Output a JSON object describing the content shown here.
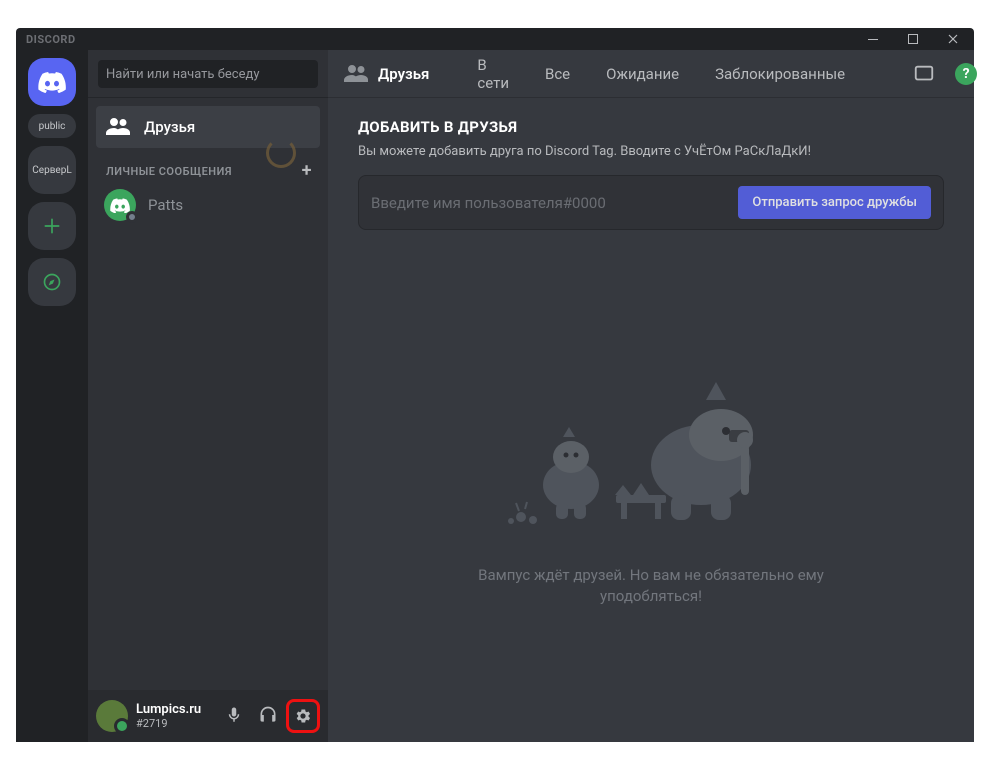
{
  "titlebar": {
    "app_name": "DISCORD"
  },
  "servers": {
    "public_label": "public",
    "server2_label": "СерверL"
  },
  "search": {
    "placeholder": "Найти или начать беседу"
  },
  "channels": {
    "friends_label": "Друзья",
    "dm_header": "ЛИЧНЫЕ СООБЩЕНИЯ",
    "dm_items": [
      {
        "name": "Patts"
      }
    ]
  },
  "user": {
    "name": "Lumpics.ru",
    "tag": "#2719"
  },
  "topbar": {
    "friends_label": "Друзья",
    "tabs": {
      "online": "В сети",
      "all": "Все",
      "pending": "Ожидание",
      "blocked": "Заблокированные"
    }
  },
  "add_friend": {
    "title": "ДОБАВИТЬ В ДРУЗЬЯ",
    "subtitle": "Вы можете добавить друга по Discord Tag. Вводите с УчЁтОм РаСкЛаДкИ!",
    "placeholder": "Введите имя пользователя#0000",
    "button": "Отправить запрос дружбы"
  },
  "empty": {
    "text": "Вампус ждёт друзей. Но вам не обязательно ему уподобляться!"
  }
}
